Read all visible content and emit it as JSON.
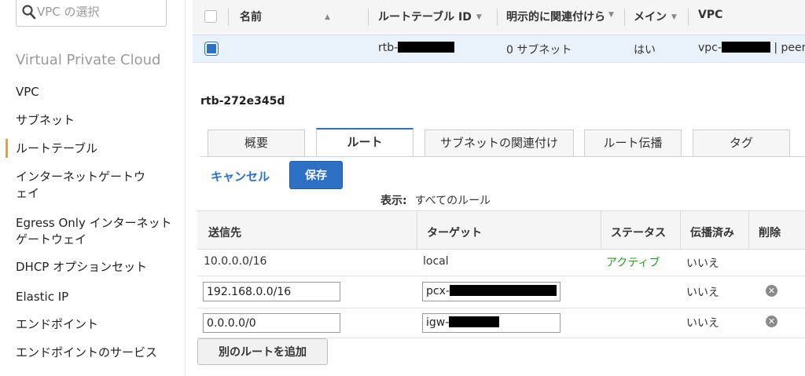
{
  "sidebar": {
    "search_placeholder": "VPC の選択",
    "heading": "Virtual Private Cloud",
    "items": [
      {
        "label": "VPC"
      },
      {
        "label": "サブネット"
      },
      {
        "label": "ルートテーブル",
        "active": true
      },
      {
        "label": "インターネットゲートウェイ"
      },
      {
        "label": "Egress Only インターネットゲートウェイ"
      },
      {
        "label": "DHCP オプションセット"
      },
      {
        "label": "Elastic IP"
      },
      {
        "label": "エンドポイント"
      },
      {
        "label": "エンドポイントのサービス"
      }
    ]
  },
  "route_tables": {
    "columns": [
      "名前",
      "ルートテーブル ID",
      "明示的に関連付けら",
      "メイン",
      "VPC"
    ],
    "row": {
      "name": "",
      "id_prefix": "rtb-",
      "explicit": "0 サブネット",
      "main": "はい",
      "vpc_prefix": "vpc-",
      "vpc_suffix": "| peer_"
    }
  },
  "detail": {
    "title": "rtb-272e345d",
    "tabs": [
      "概要",
      "ルート",
      "サブネットの関連付け",
      "ルート伝播",
      "タグ"
    ],
    "active_tab": "ルート",
    "cancel_label": "キャンセル",
    "save_label": "保存",
    "filter_label": "表示:",
    "filter_value": "すべてのルール",
    "routes_columns": [
      "送信先",
      "ターゲット",
      "ステータス",
      "伝播済み",
      "削除"
    ],
    "routes": [
      {
        "destination": "10.0.0.0/16",
        "target": "local",
        "status": "アクティブ",
        "propagated": "いいえ",
        "editable": false
      },
      {
        "destination": "192.168.0.0/16",
        "target_prefix": "pcx-",
        "status": "",
        "propagated": "いいえ",
        "editable": true
      },
      {
        "destination": "0.0.0.0/0",
        "target_prefix": "igw-",
        "status": "",
        "propagated": "いいえ",
        "editable": true
      }
    ],
    "add_route_label": "別のルートを追加"
  },
  "colors": {
    "accent": "#2d70c4",
    "active_nav": "#f0a020",
    "status_active": "#2d9a2d"
  }
}
